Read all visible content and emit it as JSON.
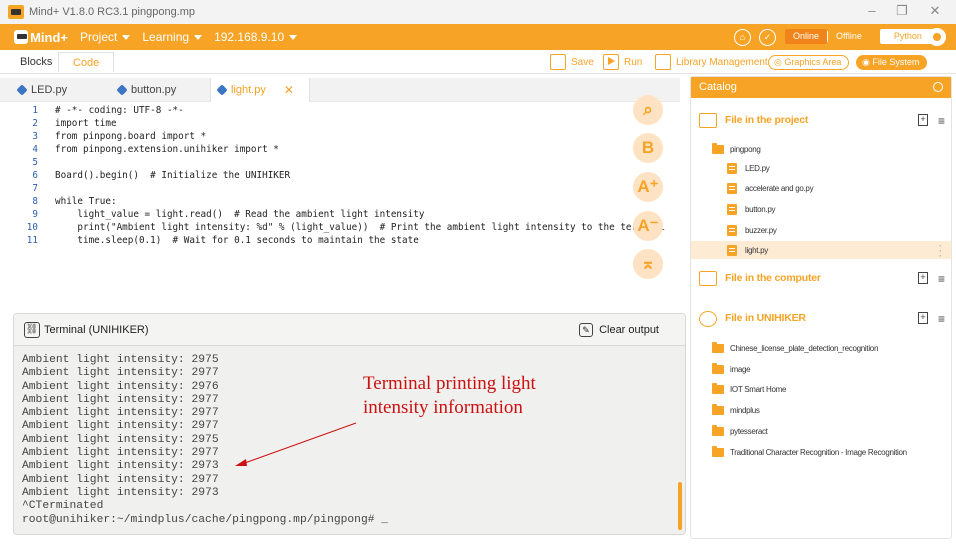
{
  "window": {
    "title": "Mind+ V1.8.0 RC3.1   pingpong.mp"
  },
  "menubar": {
    "logo_text": "Mind+",
    "project": "Project",
    "learning": "Learning",
    "ip": "192.168.9.10",
    "modes": {
      "online": "Online",
      "offline": "Offline",
      "python": "Python"
    }
  },
  "toolbar": {
    "blocks": "Blocks",
    "code": "Code",
    "save": "Save",
    "run": "Run",
    "library": "Library Management",
    "graphics": "Graphics Area",
    "filesystem": "File System"
  },
  "editor": {
    "tabs": [
      {
        "label": "LED.py"
      },
      {
        "label": "button.py"
      },
      {
        "label": "light.py"
      }
    ],
    "lines": [
      {
        "n": "1",
        "text": "# -*- coding: UTF-8 -*-"
      },
      {
        "n": "2",
        "text": "import time"
      },
      {
        "n": "3",
        "text": "from pinpong.board import *"
      },
      {
        "n": "4",
        "text": "from pinpong.extension.unihiker import *"
      },
      {
        "n": "5",
        "text": ""
      },
      {
        "n": "6",
        "text": "Board().begin()  # Initialize the UNIHIKER"
      },
      {
        "n": "7",
        "text": ""
      },
      {
        "n": "8",
        "text": "while True:"
      },
      {
        "n": "9",
        "text": "    light_value = light.read()  # Read the ambient light intensity"
      },
      {
        "n": "10",
        "text": "    print(\"Ambient light intensity: %d\" % (light_value))  # Print the ambient light intensity to the terminal"
      },
      {
        "n": "11",
        "text": "    time.sleep(0.1)  # Wait for 0.1 seconds to maintain the state"
      }
    ]
  },
  "terminal": {
    "title": "Terminal (UNIHIKER)",
    "clear": "Clear output",
    "lines": [
      "Ambient light intensity: 2975",
      "Ambient light intensity: 2977",
      "Ambient light intensity: 2976",
      "Ambient light intensity: 2977",
      "Ambient light intensity: 2977",
      "Ambient light intensity: 2977",
      "Ambient light intensity: 2975",
      "Ambient light intensity: 2977",
      "Ambient light intensity: 2973",
      "Ambient light intensity: 2977",
      "Ambient light intensity: 2973",
      "^CTerminated",
      "root@unihiker:~/mindplus/cache/pingpong.mp/pingpong# _"
    ]
  },
  "annotation": {
    "line1": "Terminal printing light",
    "line2": "intensity information"
  },
  "catalog": {
    "title": "Catalog",
    "project": {
      "title": "File in the project",
      "folder": "pingpong",
      "files": [
        "LED.py",
        "accelerate and go.py",
        "button.py",
        "buzzer.py",
        "light.py"
      ]
    },
    "computer": {
      "title": "File in the computer"
    },
    "unihiker": {
      "title": "File in UNIHIKER",
      "folders": [
        "Chinese_license_plate_detection_recognition",
        "image",
        "IOT Smart Home",
        "mindplus",
        "pytesseract",
        "Traditional Character Recognition - Image Recognition"
      ]
    }
  },
  "colors": {
    "accent": "#f7a325",
    "annotation": "#cc1111",
    "link": "#2a5db0"
  }
}
